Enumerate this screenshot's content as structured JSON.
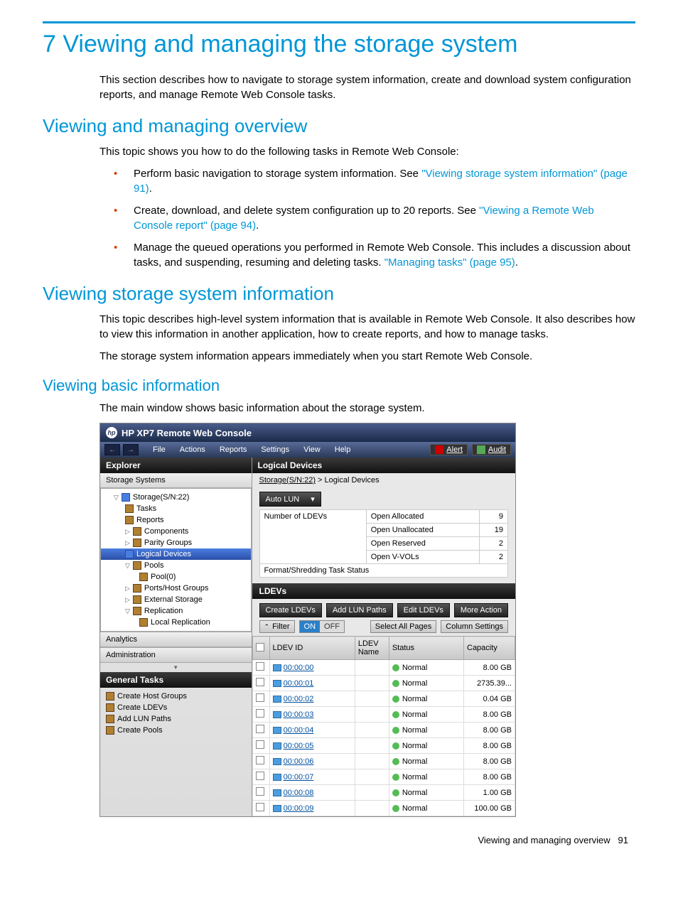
{
  "headings": {
    "h1": "7 Viewing and managing the storage system",
    "intro": "This section describes how to navigate to storage system information, create and download system configuration reports, and manage Remote Web Console tasks.",
    "h2a": "Viewing and managing overview",
    "p2a": "This topic shows you how to do the following tasks in Remote Web Console:",
    "b1_pre": "Perform basic navigation to storage system information. See ",
    "b1_link": "\"Viewing storage system information\" (page 91)",
    "b1_post": ".",
    "b2_pre": "Create, download, and delete system configuration up to 20 reports. See ",
    "b2_link": "\"Viewing a Remote Web Console report\" (page 94)",
    "b2_post": ".",
    "b3_pre": "Manage the queued operations you performed in Remote Web Console. This includes a discussion about tasks, and suspending, resuming and deleting tasks. ",
    "b3_link": "\"Managing tasks\" (page 95)",
    "b3_post": ".",
    "h2b": "Viewing storage system information",
    "p2b": "This topic describes high-level system information that is available in Remote Web Console. It also describes how to view this information in another application, how to create reports, and how to manage tasks.",
    "p2b2": "The storage system information appears immediately when you start Remote Web Console.",
    "h3a": "Viewing basic information",
    "p3a": "The main window shows basic information about the storage system."
  },
  "console": {
    "title": "HP XP7 Remote Web Console",
    "menu": {
      "file": "File",
      "actions": "Actions",
      "reports": "Reports",
      "settings": "Settings",
      "view": "View",
      "help": "Help",
      "alert": "Alert",
      "audit": "Audit"
    },
    "explorer": "Explorer",
    "storage_systems": "Storage Systems",
    "tree": {
      "root": "Storage(S/N:22)",
      "tasks": "Tasks",
      "reports": "Reports",
      "components": "Components",
      "parity": "Parity Groups",
      "logical": "Logical Devices",
      "pools": "Pools",
      "pool0": "Pool(0)",
      "ports": "Ports/Host Groups",
      "external": "External Storage",
      "replication": "Replication",
      "localrep": "Local Replication"
    },
    "analytics": "Analytics",
    "administration": "Administration",
    "general_tasks": "General Tasks",
    "gtasks": {
      "chg": "Create Host Groups",
      "cldevs": "Create LDEVs",
      "addlun": "Add LUN Paths",
      "cpools": "Create Pools"
    },
    "main": {
      "title": "Logical Devices",
      "breadcrumb_root": "Storage(S/N:22)",
      "breadcrumb_sep": " > ",
      "breadcrumb_leaf": "Logical Devices",
      "auto_lun": "Auto LUN",
      "num_ldevs": "Number of LDEVs",
      "open_allocated": "Open Allocated",
      "open_allocated_v": "9",
      "open_unallocated": "Open Unallocated",
      "open_unallocated_v": "19",
      "open_reserved": "Open Reserved",
      "open_reserved_v": "2",
      "open_vvols": "Open V-VOLs",
      "open_vvols_v": "2",
      "fmt_status": "Format/Shredding Task Status",
      "ldevs": "LDEVs",
      "btn_create": "Create LDEVs",
      "btn_addlun": "Add LUN Paths",
      "btn_edit": "Edit LDEVs",
      "btn_more": "More Action",
      "filter": "Filter",
      "on": "ON",
      "off": "OFF",
      "select_all": "Select All Pages",
      "col_settings": "Column Settings",
      "col_id": "LDEV ID",
      "col_name": "LDEV Name",
      "col_status": "Status",
      "col_cap": "Capacity",
      "rows": [
        {
          "id": "00:00:00",
          "status": "Normal",
          "cap": "8.00 GB"
        },
        {
          "id": "00:00:01",
          "status": "Normal",
          "cap": "2735.39..."
        },
        {
          "id": "00:00:02",
          "status": "Normal",
          "cap": "0.04 GB"
        },
        {
          "id": "00:00:03",
          "status": "Normal",
          "cap": "8.00 GB"
        },
        {
          "id": "00:00:04",
          "status": "Normal",
          "cap": "8.00 GB"
        },
        {
          "id": "00:00:05",
          "status": "Normal",
          "cap": "8.00 GB"
        },
        {
          "id": "00:00:06",
          "status": "Normal",
          "cap": "8.00 GB"
        },
        {
          "id": "00:00:07",
          "status": "Normal",
          "cap": "8.00 GB"
        },
        {
          "id": "00:00:08",
          "status": "Normal",
          "cap": "1.00 GB"
        },
        {
          "id": "00:00:09",
          "status": "Normal",
          "cap": "100.00 GB"
        }
      ]
    }
  },
  "footer": {
    "label": "Viewing and managing overview",
    "page": "91"
  }
}
